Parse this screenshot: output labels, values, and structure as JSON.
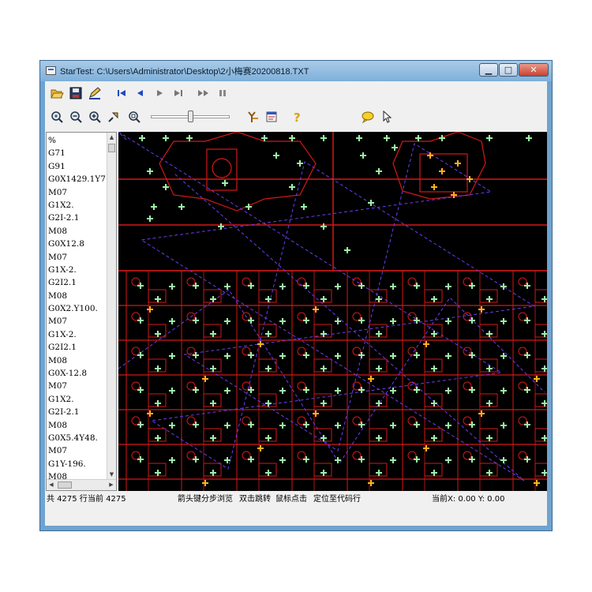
{
  "window": {
    "title": "StarTest: C:\\Users\\Administrator\\Desktop\\2小梅赛20200818.TXT",
    "controls": {
      "minimize": "▁",
      "maximize": "□",
      "close": "✕"
    }
  },
  "toolbar1": [
    {
      "name": "open-folder-icon"
    },
    {
      "name": "save-icon"
    },
    {
      "name": "edit-icon"
    },
    {
      "name": "first-icon"
    },
    {
      "name": "prev-icon"
    },
    {
      "name": "play-icon"
    },
    {
      "name": "last-icon"
    },
    {
      "name": "fast-forward-icon"
    },
    {
      "name": "pause-icon"
    }
  ],
  "toolbar2": [
    {
      "name": "zoom-fit-icon"
    },
    {
      "name": "zoom-out-icon"
    },
    {
      "name": "zoom-in-icon"
    },
    {
      "name": "pan-icon"
    },
    {
      "name": "zoom-window-icon"
    },
    {
      "name": "settings-icon"
    },
    {
      "name": "info-icon"
    },
    {
      "name": "help-icon"
    },
    {
      "name": "chat-icon"
    },
    {
      "name": "pointer-icon"
    }
  ],
  "speed_slider": {
    "value": 0.5
  },
  "code_lines": [
    "%",
    "G71",
    "G91",
    "G0X1429.1Y7",
    "M07",
    "G1X2.",
    "G2I-2.1",
    "M08",
    "G0X12.8",
    "M07",
    "G1X-2.",
    "G2I2.1",
    "M08",
    "G0X2.Y100.",
    "M07",
    "G1X-2.",
    "G2I2.1",
    "M08",
    "G0X-12.8",
    "M07",
    "G1X2.",
    "G2I-2.1",
    "M08",
    "G0X5.4Y48.",
    "M07",
    "G1Y-196.",
    "M08"
  ],
  "status": {
    "total": "共 4275 行",
    "current": "当前 4275",
    "hint1": "箭头键分步浏览",
    "hint2": "双击跳转",
    "hint3": "鼠标点击",
    "hint4": "定位至代码行",
    "coords": "当前X: 0.00  Y: 0.00"
  },
  "colors": {
    "canvas_bg": "#000000",
    "cut_path": "#d41818",
    "rapid_move": "#6a3df0",
    "point_green": "#9ef0a8",
    "point_orange": "#ffb020"
  }
}
